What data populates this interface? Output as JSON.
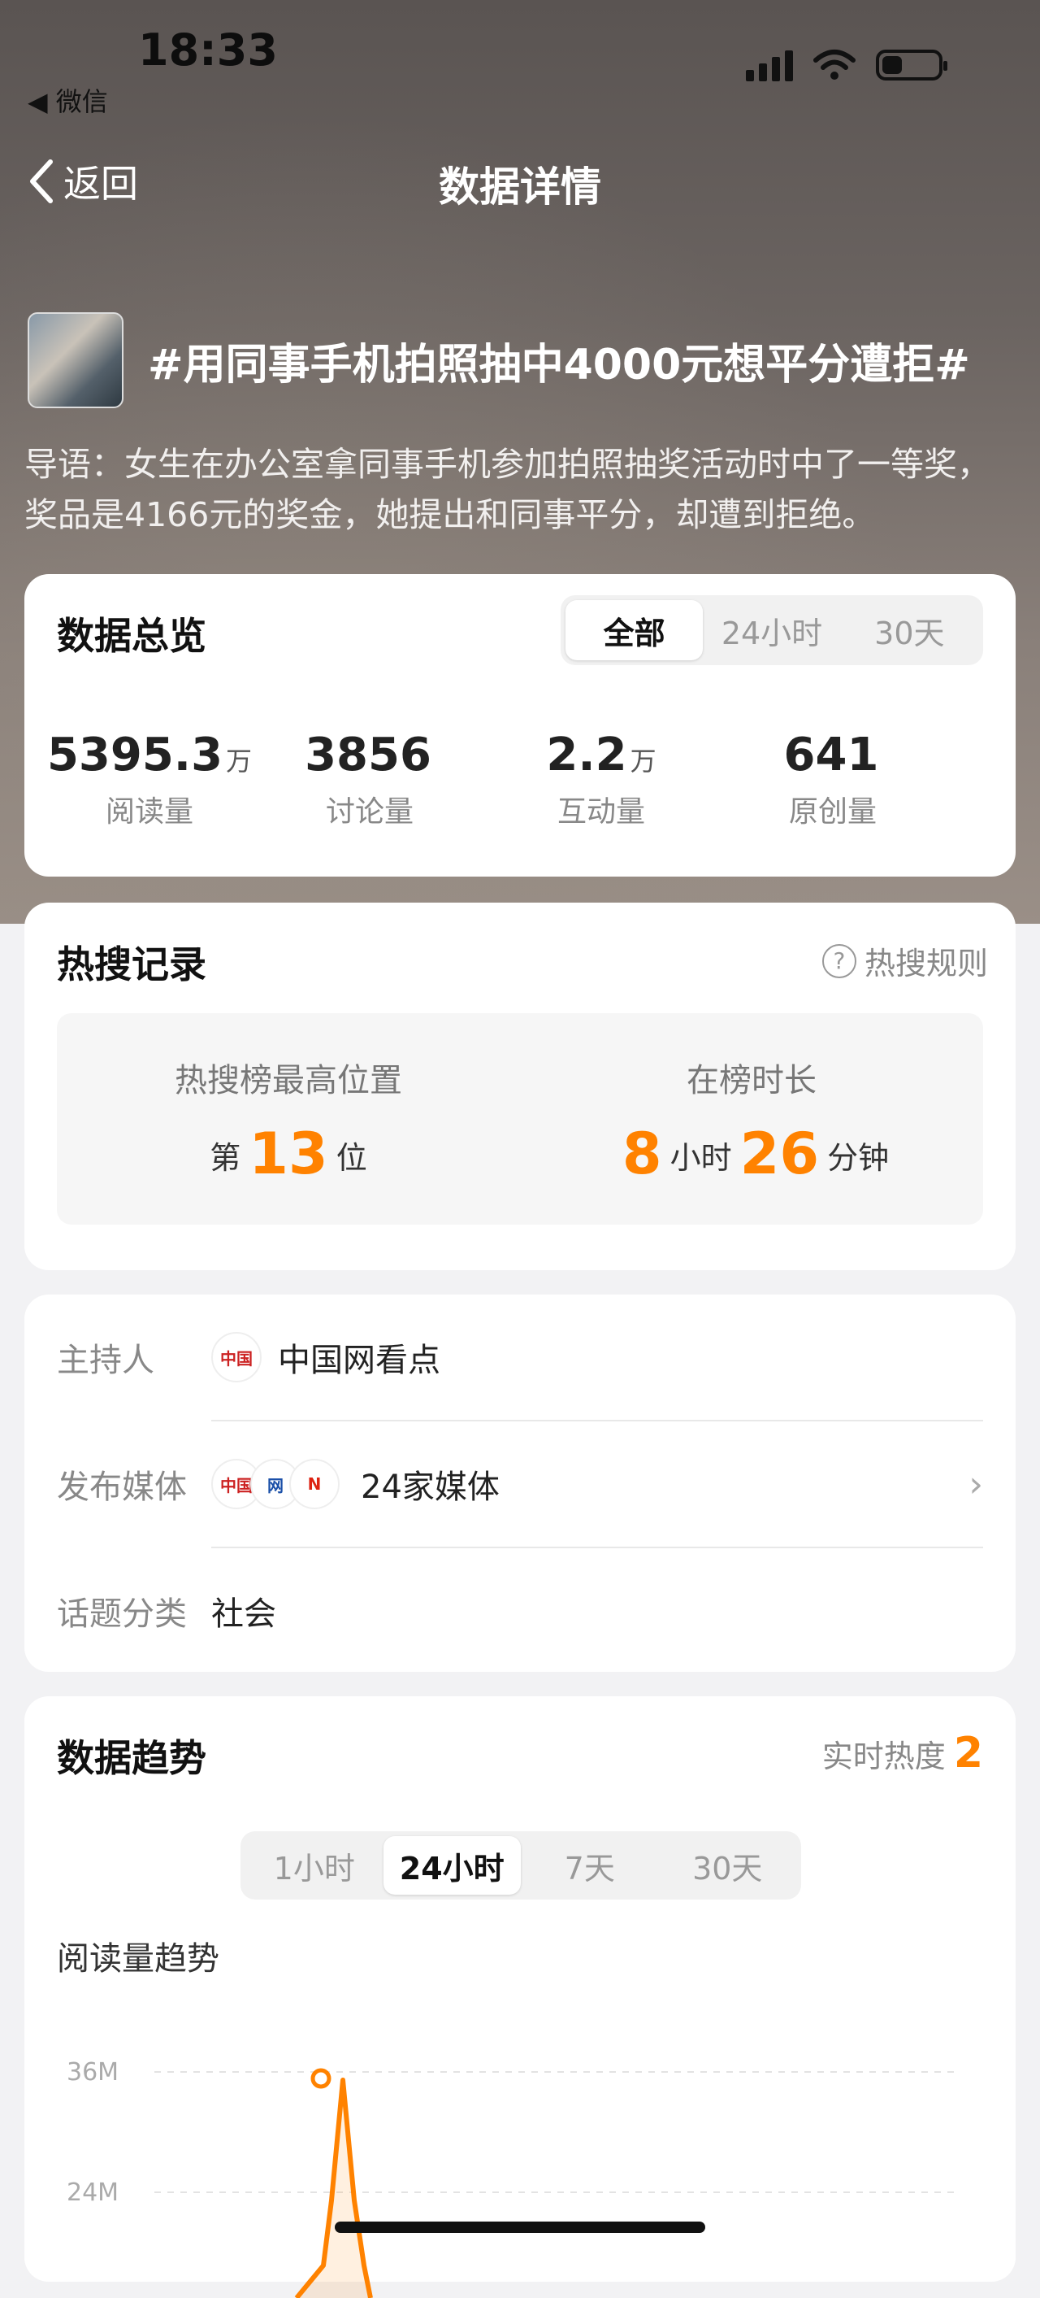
{
  "status_bar": {
    "time": "18:33",
    "back_app": "◀ 微信"
  },
  "nav": {
    "back_label": "返回",
    "title": "数据详情"
  },
  "topic": {
    "title": "#用同事手机拍照抽中4000元想平分遭拒#",
    "intro": "导语：女生在办公室拿同事手机参加拍照抽奖活动时中了一等奖，奖品是4166元的奖金，她提出和同事平分，却遭到拒绝。"
  },
  "overview": {
    "title": "数据总览",
    "tabs": [
      "全部",
      "24小时",
      "30天"
    ],
    "active_tab": 0,
    "stats": [
      {
        "value": "5395.3",
        "unit": "万",
        "label": "阅读量"
      },
      {
        "value": "3856",
        "unit": "",
        "label": "讨论量"
      },
      {
        "value": "2.2",
        "unit": "万",
        "label": "互动量"
      },
      {
        "value": "641",
        "unit": "",
        "label": "原创量"
      }
    ]
  },
  "hot_search": {
    "title": "热搜记录",
    "rules_label": "热搜规则",
    "rank_title": "热搜榜最高位置",
    "rank_prefix": "第",
    "rank_value": "13",
    "rank_suffix": "位",
    "duration_title": "在榜时长",
    "hours": "8",
    "hours_unit": "小时",
    "minutes": "26",
    "minutes_unit": "分钟"
  },
  "info": {
    "host_label": "主持人",
    "host_value": "中国网看点",
    "media_label": "发布媒体",
    "media_value": "24家媒体",
    "category_label": "话题分类",
    "category_value": "社会"
  },
  "trend": {
    "title": "数据趋势",
    "realtime_label": "实时热度",
    "realtime_value": "2",
    "tabs": [
      "1小时",
      "24小时",
      "7天",
      "30天"
    ],
    "active_tab": 1,
    "chart_title": "阅读量趋势"
  },
  "chart_data": {
    "type": "line",
    "ytick_labels": [
      "36M",
      "24M"
    ],
    "series": [
      {
        "values_visible": [
          36
        ]
      }
    ],
    "color": "#ff8200"
  }
}
